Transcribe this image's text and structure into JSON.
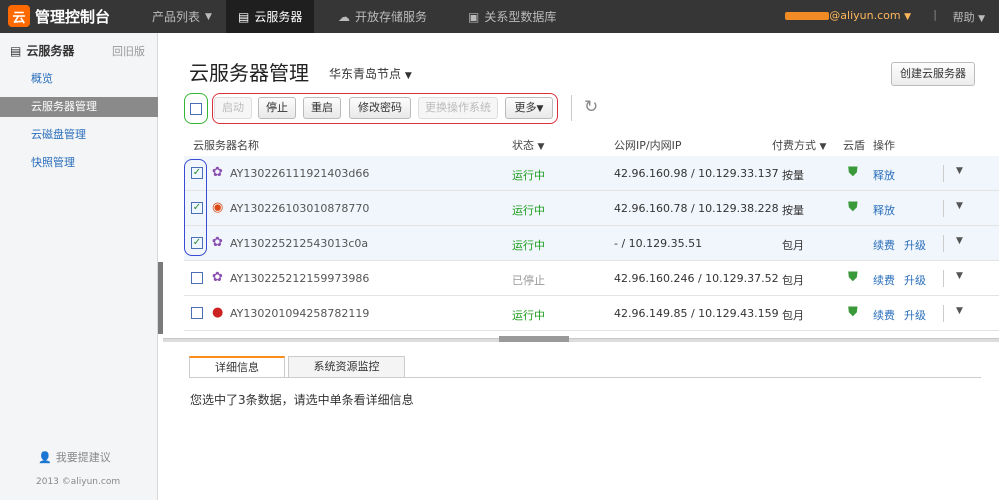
{
  "topbar": {
    "logo_icon": "云",
    "logo_text": "管理控制台",
    "nav": [
      {
        "label": "产品列表",
        "icon": "none"
      },
      {
        "label": "云服务器",
        "icon": "server-icon"
      },
      {
        "label": "开放存储服务",
        "icon": "cloud-icon"
      },
      {
        "label": "关系型数据库",
        "icon": "database-icon"
      }
    ],
    "user_suffix": "@aliyun.com",
    "help": "帮助"
  },
  "sidebar": {
    "title": "云服务器",
    "old_version": "回旧版",
    "items": [
      "概览",
      "云服务器管理",
      "云磁盘管理",
      "快照管理"
    ],
    "active_index": 1,
    "suggest": "我要提建议",
    "copyright": "2013 ©aliyun.com"
  },
  "main": {
    "title": "云服务器管理",
    "region": "华东青岛节点",
    "create_button": "创建云服务器",
    "toolbar": {
      "start": "启动",
      "stop": "停止",
      "restart": "重启",
      "reset_password": "修改密码",
      "change_os": "更换操作系统",
      "more": "更多"
    },
    "columns": {
      "name": "云服务器名称",
      "status": "状态",
      "ip": "公网IP/内网IP",
      "billing": "付费方式",
      "shield": "云盾",
      "actions": "操作"
    },
    "rows": [
      {
        "name": "AY130226111921403d66",
        "status": "运行中",
        "ip": "42.96.160.98 / 10.129.33.137",
        "billing": "按量",
        "action1": "释放",
        "action2": "",
        "checked": true,
        "os_icon": "linux-icon"
      },
      {
        "name": "AY130226103010878770",
        "status": "运行中",
        "ip": "42.96.160.78 / 10.129.38.228",
        "billing": "按量",
        "action1": "释放",
        "action2": "",
        "checked": true,
        "os_icon": "ubuntu-icon"
      },
      {
        "name": "AY130225212543013c0a",
        "status": "运行中",
        "ip": "- / 10.129.35.51",
        "billing": "包月",
        "action1": "续费",
        "action2": "升级",
        "checked": true,
        "os_icon": "linux-icon"
      },
      {
        "name": "AY130225212159973986",
        "status": "已停止",
        "ip": "42.96.160.246 / 10.129.37.52",
        "billing": "包月",
        "action1": "续费",
        "action2": "升级",
        "checked": false,
        "os_icon": "linux-icon"
      },
      {
        "name": "AY130201094258782119",
        "status": "运行中",
        "ip": "42.96.149.85 / 10.129.43.159",
        "billing": "包月",
        "action1": "续费",
        "action2": "升级",
        "checked": false,
        "os_icon": "redhat-icon"
      }
    ],
    "tabs": [
      "详细信息",
      "系统资源监控"
    ],
    "detail_text": "您选中了3条数据，请选中单条看详细信息"
  },
  "colors": {
    "topbar": "#363636",
    "accent": "#ff6a00",
    "running": "#1d9d1d",
    "link": "#2a6ebb"
  }
}
